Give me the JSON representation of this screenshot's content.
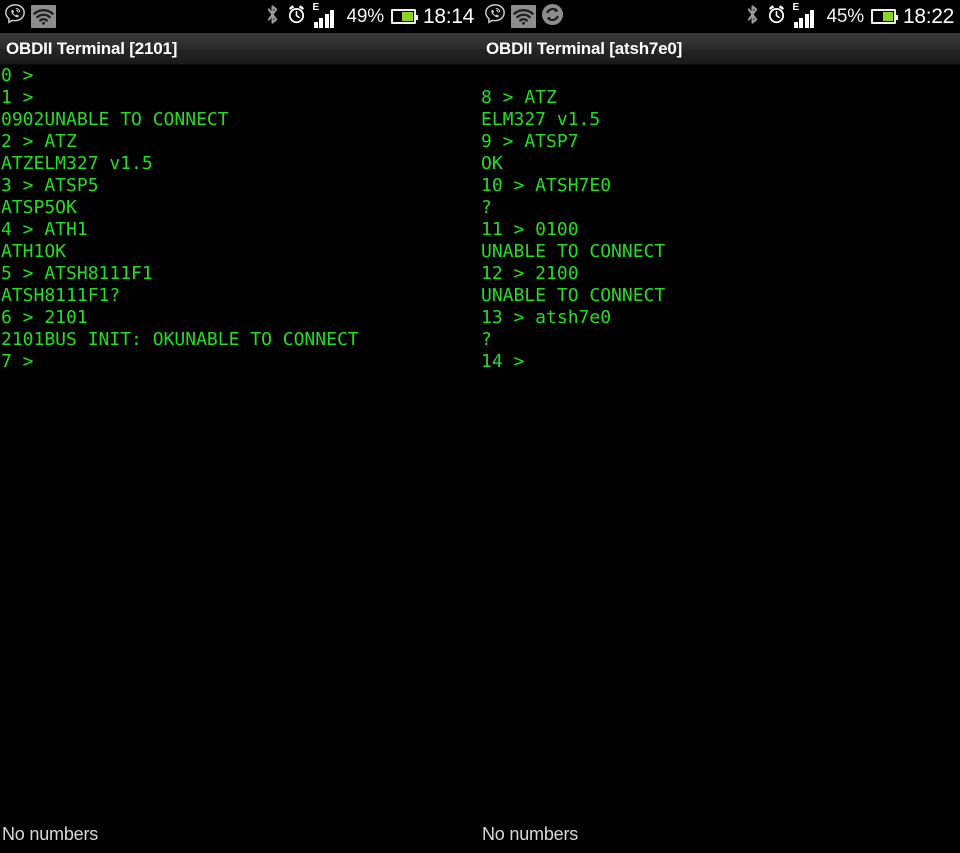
{
  "panels": [
    {
      "statusbar": {
        "icons_left": [
          "viber-icon",
          "wifi-icon"
        ],
        "icons_right": [
          "bluetooth-icon",
          "alarm-clock-icon",
          "edge-signal-icon",
          "battery-icon"
        ],
        "signal_label": "E",
        "battery_percent": "49%",
        "clock": "18:14"
      },
      "titlebar": {
        "title": "OBDII Terminal [2101]"
      },
      "terminal": {
        "lines": [
          "0 >",
          "1 >",
          "0902UNABLE TO CONNECT",
          "2 > ATZ",
          "ATZELM327 v1.5",
          "3 > ATSP5",
          "ATSP5OK",
          "4 > ATH1",
          "ATH1OK",
          "5 > ATSH8111F1",
          "ATSH8111F1?",
          "6 > 2101",
          "2101BUS INIT: OKUNABLE TO CONNECT",
          "7 >"
        ],
        "text_color": "#22dd22",
        "background": "#000000",
        "leading_blank_lines": 0
      },
      "bottombar": {
        "status": "No numbers"
      }
    },
    {
      "statusbar": {
        "icons_left": [
          "viber-icon",
          "wifi-icon",
          "sync-icon"
        ],
        "icons_right": [
          "bluetooth-icon",
          "alarm-clock-icon",
          "edge-signal-icon",
          "battery-icon"
        ],
        "signal_label": "E",
        "battery_percent": "45%",
        "clock": "18:22"
      },
      "titlebar": {
        "title": "OBDII Terminal [atsh7e0]"
      },
      "terminal": {
        "lines": [
          "8 > ATZ",
          "ELM327 v1.5",
          "9 > ATSP7",
          "OK",
          "10 > ATSH7E0",
          "?",
          "11 > 0100",
          "UNABLE TO CONNECT",
          "12 > 2100",
          "UNABLE TO CONNECT",
          "13 > atsh7e0",
          "?",
          "14 >"
        ],
        "text_color": "#22dd22",
        "background": "#000000",
        "leading_blank_lines": 1
      },
      "bottombar": {
        "status": "No numbers"
      }
    }
  ]
}
